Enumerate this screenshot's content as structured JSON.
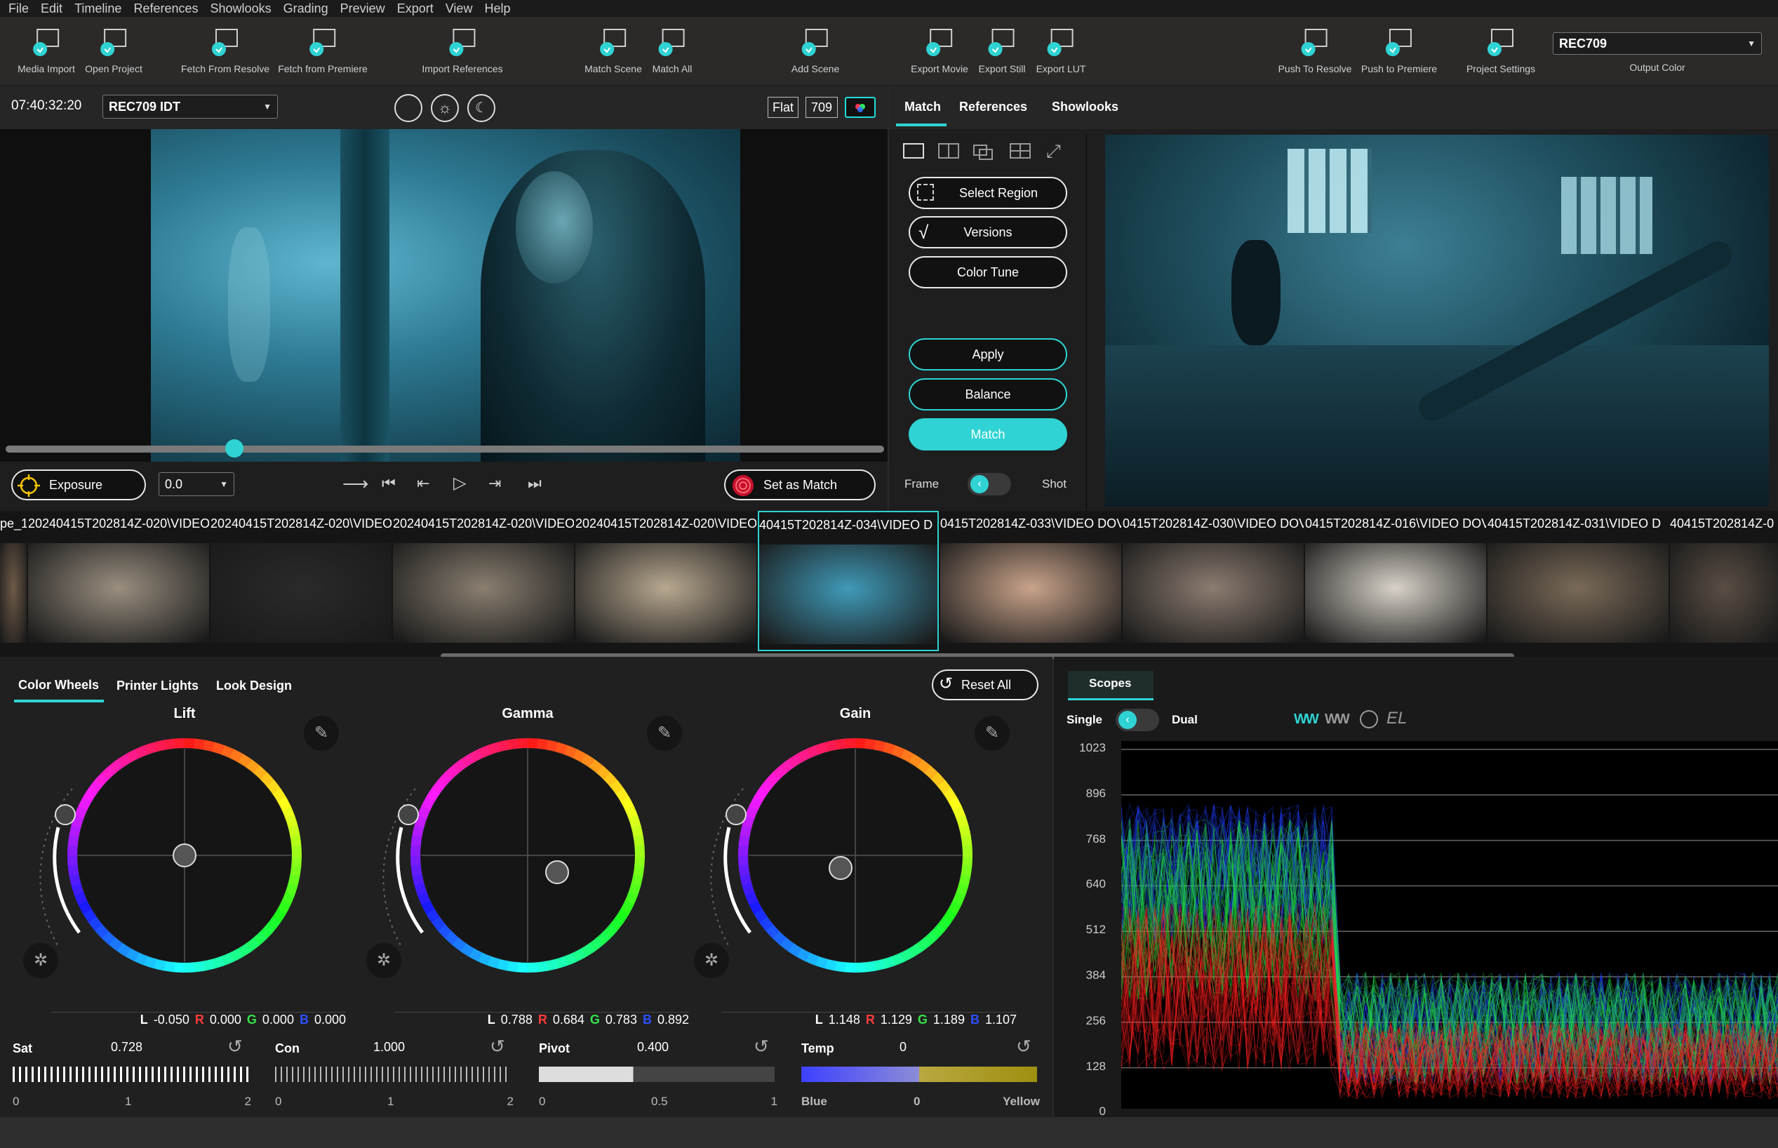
{
  "menu": [
    "File",
    "Edit",
    "Timeline",
    "References",
    "Showlooks",
    "Grading",
    "Preview",
    "Export",
    "View",
    "Help"
  ],
  "toolbar": {
    "items": [
      {
        "label": "Media Import",
        "icon": "media-import-icon"
      },
      {
        "label": "Open Project",
        "icon": "open-project-icon"
      },
      {
        "label": "Fetch From Resolve",
        "icon": "resolve-icon"
      },
      {
        "label": "Fetch from Premiere",
        "icon": "premiere-icon"
      },
      {
        "label": "Import References",
        "icon": "import-references-icon"
      },
      {
        "label": "Match Scene",
        "icon": "match-scene-icon"
      },
      {
        "label": "Match All",
        "icon": "match-all-icon"
      },
      {
        "label": "Add Scene",
        "icon": "add-scene-icon"
      },
      {
        "label": "Export Movie",
        "icon": "export-movie-icon"
      },
      {
        "label": "Export Still",
        "icon": "export-still-icon"
      },
      {
        "label": "Export LUT",
        "icon": "export-lut-icon"
      },
      {
        "label": "Push To Resolve",
        "icon": "resolve-icon"
      },
      {
        "label": "Push to Premiere",
        "icon": "premiere-icon"
      },
      {
        "label": "Project Settings",
        "icon": "gear-icon"
      }
    ],
    "output_color_value": "REC709",
    "output_color_label": "Output Color"
  },
  "viewer": {
    "timecode": "07:40:32:20",
    "idt": "REC709 IDT",
    "flat_label": "Flat",
    "rec709_label": "709",
    "scrub_position": 0.26,
    "exposure_label": "Exposure",
    "exposure_value": "0.0",
    "set_as_match_label": "Set as Match"
  },
  "right_panel": {
    "tabs": [
      "Match",
      "References",
      "Showlooks"
    ],
    "active_tab": "Match",
    "select_region": "Select Region",
    "versions": "Versions",
    "color_tune": "Color Tune",
    "apply": "Apply",
    "balance": "Balance",
    "match": "Match",
    "frame_label": "Frame",
    "shot_label": "Shot"
  },
  "clips": [
    {
      "name": "pe_1"
    },
    {
      "name": "20240415T202814Z-020\\VIDEO"
    },
    {
      "name": "20240415T202814Z-020\\VIDEO"
    },
    {
      "name": "20240415T202814Z-020\\VIDEO"
    },
    {
      "name": "20240415T202814Z-020\\VIDEO"
    },
    {
      "name": "40415T202814Z-034\\VIDEO D"
    },
    {
      "name": "0415T202814Z-033\\VIDEO DOV"
    },
    {
      "name": "0415T202814Z-030\\VIDEO DOV"
    },
    {
      "name": "0415T202814Z-016\\VIDEO DOV"
    },
    {
      "name": "40415T202814Z-031\\VIDEO D"
    },
    {
      "name": "40415T202814Z-0"
    }
  ],
  "grading": {
    "tabs": [
      "Color Wheels",
      "Printer Lights",
      "Look Design"
    ],
    "active_tab": "Color Wheels",
    "reset_all": "Reset All",
    "wheels": [
      {
        "name": "Lift",
        "L": "-0.050",
        "R": "0.000",
        "G": "0.000",
        "B": "0.000",
        "dot": [
          0,
          0
        ]
      },
      {
        "name": "Gamma",
        "L": "0.788",
        "R": "0.684",
        "G": "0.783",
        "B": "0.892",
        "dot": [
          0.28,
          0.16
        ]
      },
      {
        "name": "Gain",
        "L": "1.148",
        "R": "1.129",
        "G": "1.189",
        "B": "1.107",
        "dot": [
          -0.14,
          0.12
        ]
      }
    ],
    "letters": {
      "L": "L",
      "R": "R",
      "G": "G",
      "B": "B"
    },
    "sliders": [
      {
        "label": "Sat",
        "value": "0.728",
        "ticks": [
          "0",
          "1",
          "2"
        ]
      },
      {
        "label": "Con",
        "value": "1.000",
        "ticks": [
          "0",
          "1",
          "2"
        ]
      },
      {
        "label": "Pivot",
        "value": "0.400",
        "ticks": [
          "0",
          "0.5",
          "1"
        ]
      },
      {
        "label": "Temp",
        "value": "0",
        "ticks": [
          "Blue",
          "0",
          "Yellow"
        ]
      }
    ]
  },
  "scopes": {
    "tab": "Scopes",
    "single_label": "Single",
    "dual_label": "Dual",
    "el_label": "EL",
    "y_ticks": [
      "1023",
      "896",
      "768",
      "640",
      "512",
      "384",
      "256",
      "128",
      "0"
    ]
  }
}
